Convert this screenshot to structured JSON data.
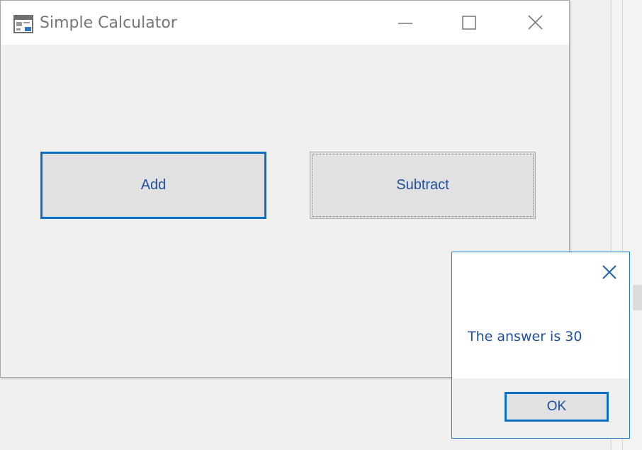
{
  "window": {
    "title": "Simple Calculator",
    "icon": "app-form-icon",
    "caption_buttons": [
      "minimize-icon",
      "maximize-icon",
      "close-icon"
    ]
  },
  "buttons": {
    "add": "Add",
    "subtract": "Subtract"
  },
  "message_box": {
    "text": "The answer is 30",
    "ok": "OK",
    "close_icon": "close-icon"
  },
  "colors": {
    "accent": "#0a6fc7",
    "button_text": "#1f4e9c",
    "button_face": "#e1e1e1",
    "window_bg": "#f0f0f0"
  }
}
